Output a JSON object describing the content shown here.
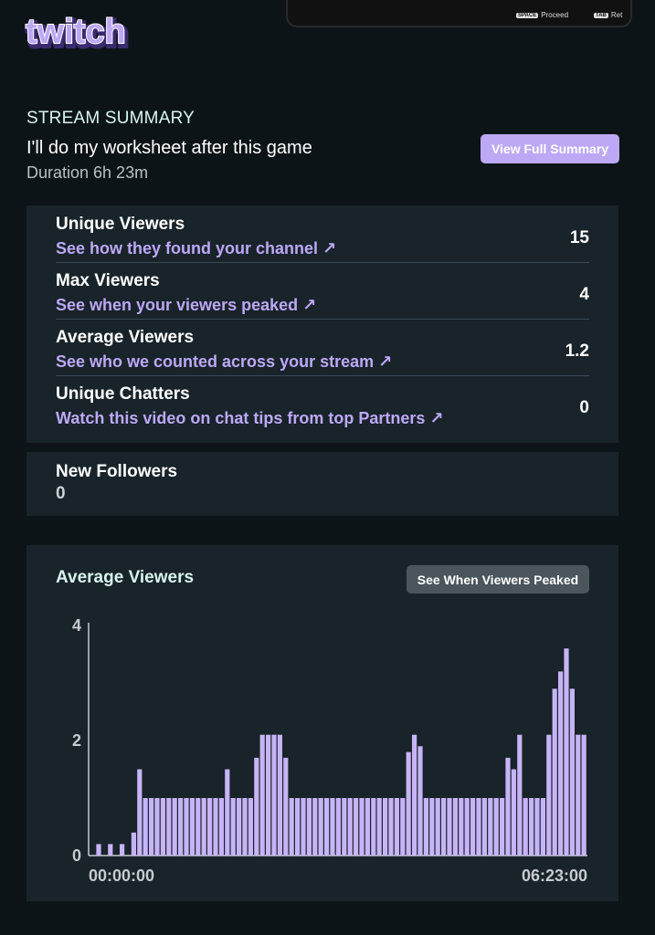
{
  "brand": {
    "name": "twitch",
    "color": "#bda8f6"
  },
  "keyboard_hints": [
    {
      "key": "SPACE",
      "label": "Proceed"
    },
    {
      "key": "TAB",
      "label": "Ret"
    }
  ],
  "summary": {
    "heading": "STREAM SUMMARY",
    "title": "I'll do my worksheet after this game",
    "duration": "Duration 6h 23m",
    "view_full_button": "View Full Summary"
  },
  "stats": [
    {
      "label": "Unique Viewers",
      "link": "See how they found your channel ↗",
      "value": "15"
    },
    {
      "label": "Max Viewers",
      "link": "See when your viewers peaked ↗",
      "value": "4"
    },
    {
      "label": "Average Viewers",
      "link": "See who we counted across your stream ↗",
      "value": "1.2"
    },
    {
      "label": "Unique Chatters",
      "link": "Watch this video on chat tips from top Partners ↗",
      "value": "0"
    }
  ],
  "followers": {
    "label": "New Followers",
    "value": "0"
  },
  "chart_section": {
    "title": "Average Viewers",
    "peak_button": "See When Viewers Peaked"
  },
  "chart_data": {
    "type": "bar",
    "title": "Average Viewers",
    "y_ticks": [
      "4",
      "2",
      "0"
    ],
    "ylim": [
      0,
      4
    ],
    "x_labels": [
      "00:00:00",
      "06:23:00"
    ],
    "bar_color": "#c7b4f7",
    "values": [
      0,
      0.2,
      0,
      0.2,
      0,
      0.2,
      0,
      0.4,
      1.5,
      1,
      1,
      1,
      1,
      1,
      1,
      1,
      1,
      1,
      1,
      1,
      1,
      1,
      1,
      1.5,
      1,
      1,
      1,
      1,
      1.7,
      2.1,
      2.1,
      2.1,
      2.1,
      1.7,
      1,
      1,
      1,
      1,
      1,
      1,
      1,
      1,
      1,
      1,
      1,
      1,
      1,
      1,
      1,
      1,
      1,
      1,
      1,
      1,
      1.8,
      2.1,
      1.9,
      1,
      1,
      1,
      1,
      1,
      1,
      1,
      1,
      1,
      1,
      1,
      1,
      1,
      1,
      1.7,
      1.5,
      2.1,
      1,
      1,
      1,
      1,
      2.1,
      2.9,
      3.2,
      3.6,
      2.9,
      2.1,
      2.1
    ]
  }
}
